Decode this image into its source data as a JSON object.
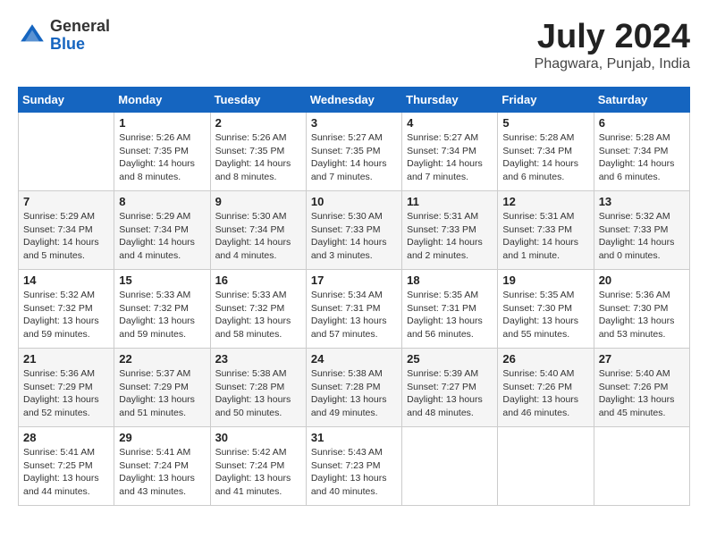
{
  "header": {
    "logo_general": "General",
    "logo_blue": "Blue",
    "month_title": "July 2024",
    "location": "Phagwara, Punjab, India"
  },
  "days_of_week": [
    "Sunday",
    "Monday",
    "Tuesday",
    "Wednesday",
    "Thursday",
    "Friday",
    "Saturday"
  ],
  "weeks": [
    [
      {
        "day": "",
        "detail": ""
      },
      {
        "day": "1",
        "detail": "Sunrise: 5:26 AM\nSunset: 7:35 PM\nDaylight: 14 hours\nand 8 minutes."
      },
      {
        "day": "2",
        "detail": "Sunrise: 5:26 AM\nSunset: 7:35 PM\nDaylight: 14 hours\nand 8 minutes."
      },
      {
        "day": "3",
        "detail": "Sunrise: 5:27 AM\nSunset: 7:35 PM\nDaylight: 14 hours\nand 7 minutes."
      },
      {
        "day": "4",
        "detail": "Sunrise: 5:27 AM\nSunset: 7:34 PM\nDaylight: 14 hours\nand 7 minutes."
      },
      {
        "day": "5",
        "detail": "Sunrise: 5:28 AM\nSunset: 7:34 PM\nDaylight: 14 hours\nand 6 minutes."
      },
      {
        "day": "6",
        "detail": "Sunrise: 5:28 AM\nSunset: 7:34 PM\nDaylight: 14 hours\nand 6 minutes."
      }
    ],
    [
      {
        "day": "7",
        "detail": "Sunrise: 5:29 AM\nSunset: 7:34 PM\nDaylight: 14 hours\nand 5 minutes."
      },
      {
        "day": "8",
        "detail": "Sunrise: 5:29 AM\nSunset: 7:34 PM\nDaylight: 14 hours\nand 4 minutes."
      },
      {
        "day": "9",
        "detail": "Sunrise: 5:30 AM\nSunset: 7:34 PM\nDaylight: 14 hours\nand 4 minutes."
      },
      {
        "day": "10",
        "detail": "Sunrise: 5:30 AM\nSunset: 7:33 PM\nDaylight: 14 hours\nand 3 minutes."
      },
      {
        "day": "11",
        "detail": "Sunrise: 5:31 AM\nSunset: 7:33 PM\nDaylight: 14 hours\nand 2 minutes."
      },
      {
        "day": "12",
        "detail": "Sunrise: 5:31 AM\nSunset: 7:33 PM\nDaylight: 14 hours\nand 1 minute."
      },
      {
        "day": "13",
        "detail": "Sunrise: 5:32 AM\nSunset: 7:33 PM\nDaylight: 14 hours\nand 0 minutes."
      }
    ],
    [
      {
        "day": "14",
        "detail": "Sunrise: 5:32 AM\nSunset: 7:32 PM\nDaylight: 13 hours\nand 59 minutes."
      },
      {
        "day": "15",
        "detail": "Sunrise: 5:33 AM\nSunset: 7:32 PM\nDaylight: 13 hours\nand 59 minutes."
      },
      {
        "day": "16",
        "detail": "Sunrise: 5:33 AM\nSunset: 7:32 PM\nDaylight: 13 hours\nand 58 minutes."
      },
      {
        "day": "17",
        "detail": "Sunrise: 5:34 AM\nSunset: 7:31 PM\nDaylight: 13 hours\nand 57 minutes."
      },
      {
        "day": "18",
        "detail": "Sunrise: 5:35 AM\nSunset: 7:31 PM\nDaylight: 13 hours\nand 56 minutes."
      },
      {
        "day": "19",
        "detail": "Sunrise: 5:35 AM\nSunset: 7:30 PM\nDaylight: 13 hours\nand 55 minutes."
      },
      {
        "day": "20",
        "detail": "Sunrise: 5:36 AM\nSunset: 7:30 PM\nDaylight: 13 hours\nand 53 minutes."
      }
    ],
    [
      {
        "day": "21",
        "detail": "Sunrise: 5:36 AM\nSunset: 7:29 PM\nDaylight: 13 hours\nand 52 minutes."
      },
      {
        "day": "22",
        "detail": "Sunrise: 5:37 AM\nSunset: 7:29 PM\nDaylight: 13 hours\nand 51 minutes."
      },
      {
        "day": "23",
        "detail": "Sunrise: 5:38 AM\nSunset: 7:28 PM\nDaylight: 13 hours\nand 50 minutes."
      },
      {
        "day": "24",
        "detail": "Sunrise: 5:38 AM\nSunset: 7:28 PM\nDaylight: 13 hours\nand 49 minutes."
      },
      {
        "day": "25",
        "detail": "Sunrise: 5:39 AM\nSunset: 7:27 PM\nDaylight: 13 hours\nand 48 minutes."
      },
      {
        "day": "26",
        "detail": "Sunrise: 5:40 AM\nSunset: 7:26 PM\nDaylight: 13 hours\nand 46 minutes."
      },
      {
        "day": "27",
        "detail": "Sunrise: 5:40 AM\nSunset: 7:26 PM\nDaylight: 13 hours\nand 45 minutes."
      }
    ],
    [
      {
        "day": "28",
        "detail": "Sunrise: 5:41 AM\nSunset: 7:25 PM\nDaylight: 13 hours\nand 44 minutes."
      },
      {
        "day": "29",
        "detail": "Sunrise: 5:41 AM\nSunset: 7:24 PM\nDaylight: 13 hours\nand 43 minutes."
      },
      {
        "day": "30",
        "detail": "Sunrise: 5:42 AM\nSunset: 7:24 PM\nDaylight: 13 hours\nand 41 minutes."
      },
      {
        "day": "31",
        "detail": "Sunrise: 5:43 AM\nSunset: 7:23 PM\nDaylight: 13 hours\nand 40 minutes."
      },
      {
        "day": "",
        "detail": ""
      },
      {
        "day": "",
        "detail": ""
      },
      {
        "day": "",
        "detail": ""
      }
    ]
  ]
}
